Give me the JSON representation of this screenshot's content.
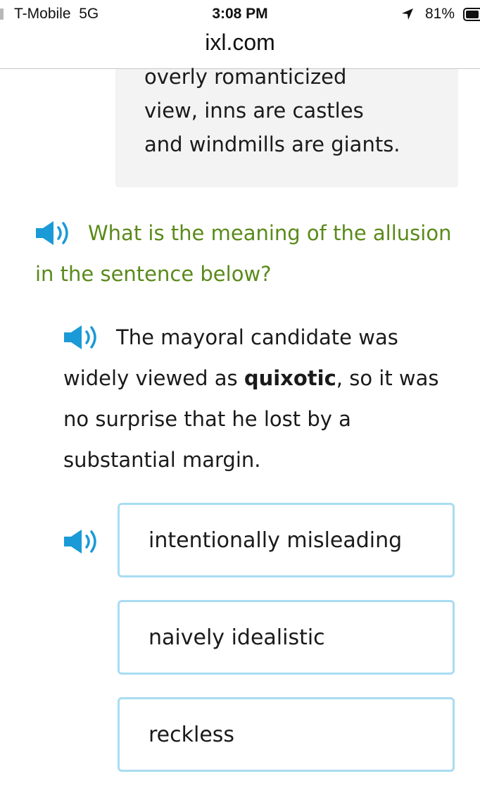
{
  "status_bar": {
    "carrier": "T-Mobile",
    "network": "5G",
    "time": "3:08 PM",
    "battery_percent": "81%",
    "battery_level": 0.81,
    "icons": [
      "signal-icon",
      "location-arrow-icon",
      "battery-icon"
    ]
  },
  "browser": {
    "url": "ixl.com"
  },
  "passage": {
    "lines": [
      "overly romanticized",
      "view, inns are castles",
      "and windmills are giants."
    ]
  },
  "question": {
    "prompt": "What is the meaning of the allusion in the sentence below?",
    "sentence_before": "The mayoral candidate was widely viewed as ",
    "sentence_bold": "quixotic",
    "sentence_after": ", so it was no surprise that he lost by a substantial margin."
  },
  "choices": [
    {
      "label": "intentionally misleading"
    },
    {
      "label": "naively idealistic"
    },
    {
      "label": "reckless"
    }
  ],
  "colors": {
    "prompt_green": "#5a8a1a",
    "speaker_blue": "#1a9ad6",
    "choice_border": "#a9dcf2",
    "passage_bg": "#f3f3f3"
  }
}
